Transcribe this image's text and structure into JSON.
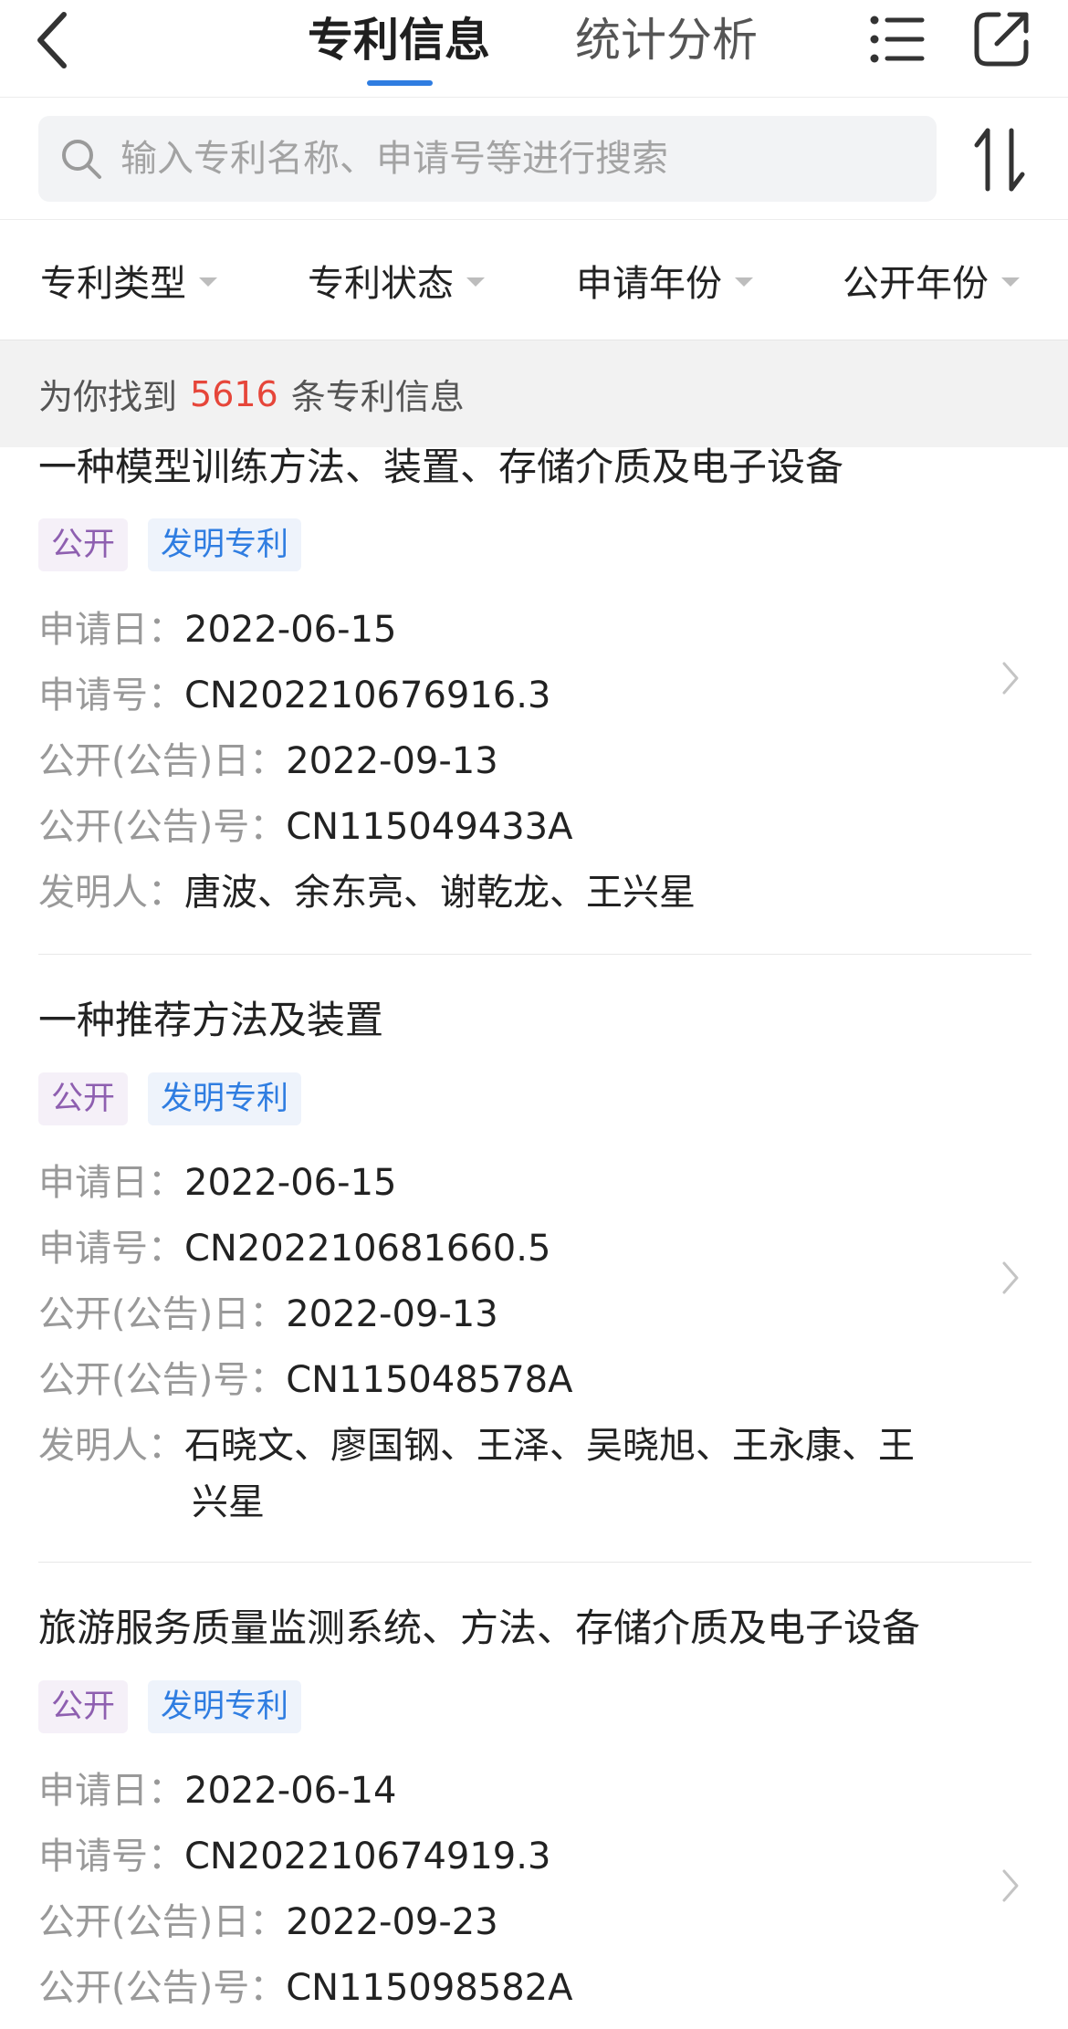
{
  "header": {
    "tabs": [
      {
        "label": "专利信息",
        "active": true
      },
      {
        "label": "统计分析",
        "active": false
      }
    ],
    "accent_color": "#2f7de1",
    "icons": [
      "back-chevron-icon",
      "list-icon",
      "share-icon"
    ]
  },
  "search": {
    "placeholder": "输入专利名称、申请号等进行搜索",
    "value": ""
  },
  "filters": [
    {
      "label": "专利类型"
    },
    {
      "label": "专利状态"
    },
    {
      "label": "申请年份"
    },
    {
      "label": "公开年份"
    }
  ],
  "summary": {
    "prefix": "为你找到",
    "count": "5616",
    "suffix": "条专利信息",
    "count_color": "#e6463a"
  },
  "labels": {
    "apply_date": "申请日：",
    "apply_no": "申请号：",
    "pub_date": "公开(公告)日：",
    "pub_no": "公开(公告)号：",
    "inventors": "发明人："
  },
  "patents": [
    {
      "title": "一种模型训练方法、装置、存储介质及电子设备",
      "status_tag": "公开",
      "type_tag": "发明专利",
      "apply_date": "2022-06-15",
      "apply_no": "CN202210676916.3",
      "pub_date": "2022-09-13",
      "pub_no": "CN115049433A",
      "inventors_line1": "唐波、余东亮、谢乾龙、王兴星",
      "inventors_line2": ""
    },
    {
      "title": "一种推荐方法及装置",
      "status_tag": "公开",
      "type_tag": "发明专利",
      "apply_date": "2022-06-15",
      "apply_no": "CN202210681660.5",
      "pub_date": "2022-09-13",
      "pub_no": "CN115048578A",
      "inventors_line1": "石晓文、廖国钢、王泽、吴晓旭、王永康、王",
      "inventors_line2": "兴星"
    },
    {
      "title": "旅游服务质量监测系统、方法、存储介质及电子设备",
      "status_tag": "公开",
      "type_tag": "发明专利",
      "apply_date": "2022-06-14",
      "apply_no": "CN202210674919.3",
      "pub_date": "2022-09-23",
      "pub_no": "CN115098582A"
    }
  ]
}
